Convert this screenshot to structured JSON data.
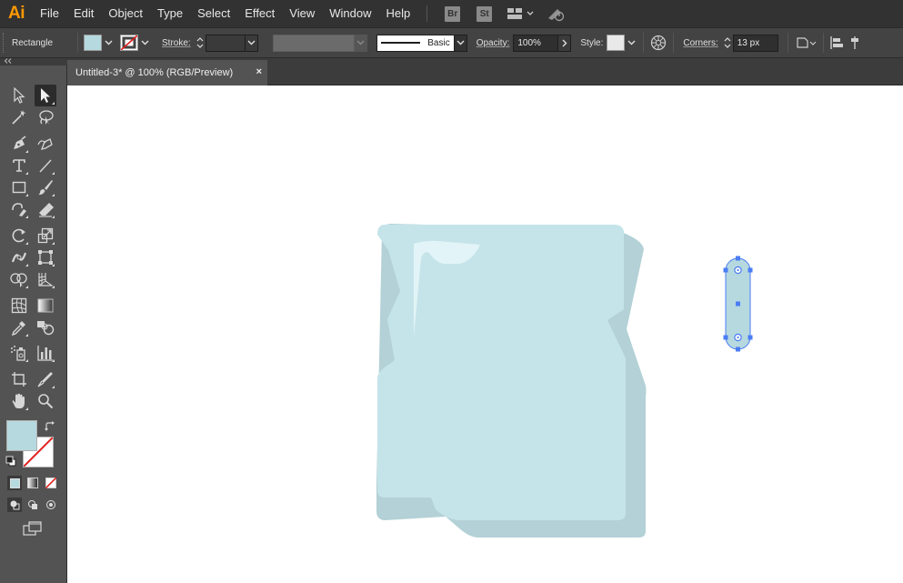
{
  "app": {
    "logo": "Ai"
  },
  "menu": {
    "items": [
      "File",
      "Edit",
      "Object",
      "Type",
      "Select",
      "Effect",
      "View",
      "Window",
      "Help"
    ],
    "badges": [
      "Br",
      "St"
    ],
    "icons": [
      "workspace-switcher-icon",
      "gpu-performance-icon"
    ]
  },
  "control_bar": {
    "object_type": "Rectangle",
    "fill_color": "#b6d9df",
    "stroke_label": "Stroke:",
    "stroke_weight": "",
    "brush_label": "Basic",
    "opacity_label": "Opacity:",
    "opacity_value": "100%",
    "style_label": "Style:",
    "corners_label": "Corners:",
    "corners_value": "13 px"
  },
  "document": {
    "tab_title": "Untitled-3* @ 100% (RGB/Preview)",
    "close_glyph": "×"
  },
  "tools": {
    "selected": "direct-selection-tool",
    "fill_swatch": "#b6d9df"
  },
  "artwork": {
    "ice_front_color": "#c5e4ea",
    "ice_shadow_color": "#b3d1d6",
    "highlight_color": "#e2f4f7",
    "selected_shape_fill": "#b6d9df",
    "selection_color": "#4a7cf5"
  }
}
